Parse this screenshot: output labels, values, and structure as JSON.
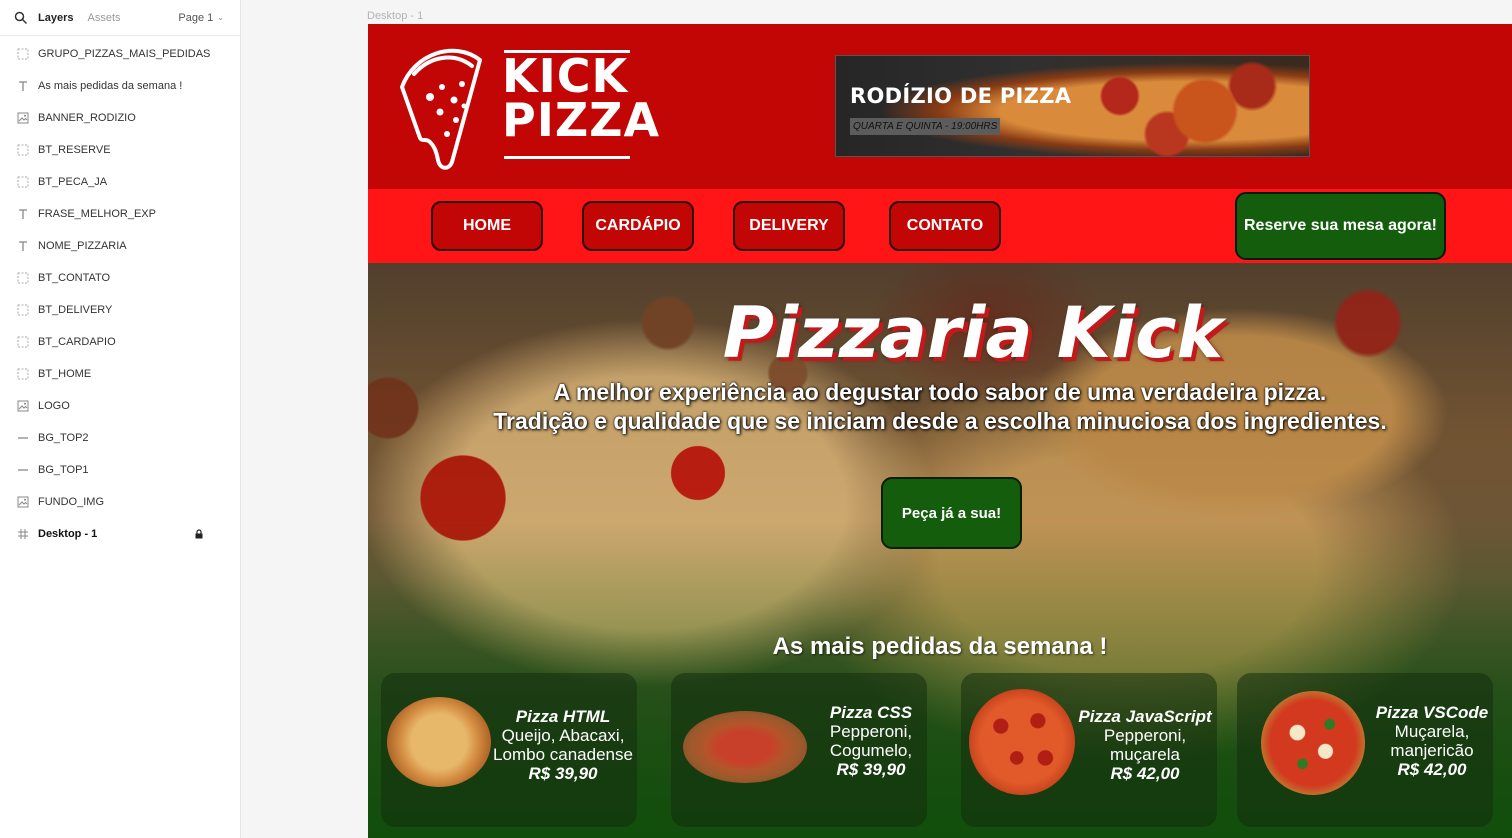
{
  "panel": {
    "tab_layers": "Layers",
    "tab_assets": "Assets",
    "page_selector": "Page 1",
    "layers": [
      {
        "label": "GRUPO_PIZZAS_MAIS_PEDIDAS",
        "icon": "frame-icon"
      },
      {
        "label": "As mais pedidas da semana !",
        "icon": "text-icon"
      },
      {
        "label": "BANNER_RODIZIO",
        "icon": "image-icon"
      },
      {
        "label": "BT_RESERVE",
        "icon": "frame-icon"
      },
      {
        "label": "BT_PECA_JA",
        "icon": "frame-icon"
      },
      {
        "label": "FRASE_MELHOR_EXP",
        "icon": "text-icon"
      },
      {
        "label": "NOME_PIZZARIA",
        "icon": "text-icon"
      },
      {
        "label": "BT_CONTATO",
        "icon": "frame-icon"
      },
      {
        "label": "BT_DELIVERY",
        "icon": "frame-icon"
      },
      {
        "label": "BT_CARDAPIO",
        "icon": "frame-icon"
      },
      {
        "label": "BT_HOME",
        "icon": "frame-icon"
      },
      {
        "label": "LOGO",
        "icon": "image-icon"
      },
      {
        "label": "BG_TOP2",
        "icon": "rectangle-icon"
      },
      {
        "label": "BG_TOP1",
        "icon": "rectangle-icon"
      },
      {
        "label": "FUNDO_IMG",
        "icon": "image-icon"
      },
      {
        "label": "Desktop - 1",
        "icon": "frame-hash-icon",
        "locked": true
      }
    ]
  },
  "canvas": {
    "frame_label": "Desktop - 1",
    "logo": {
      "line1": "KICK",
      "line2": "PIZZA"
    },
    "banner": {
      "title": "RODÍZIO DE PIZZA",
      "subtitle": "QUARTA E QUINTA - 19:00HRS"
    },
    "nav": {
      "home": "HOME",
      "cardapio": "CARDÁPIO",
      "delivery": "DELIVERY",
      "contato": "CONTATO"
    },
    "reserve_button": "Reserve sua mesa agora!",
    "hero": {
      "title": "Pizzaria Kick",
      "line1": "A melhor experiência ao degustar todo sabor de uma verdadeira pizza.",
      "line2": "Tradição e qualidade que se iniciam desde a escolha minuciosa dos ingredientes.",
      "cta": "Peça já a sua!"
    },
    "mais_pedidas": "As mais pedidas da semana !",
    "pizzas": [
      {
        "name": "Pizza HTML",
        "desc1": "Queijo, Abacaxi,",
        "desc2": "Lombo canadense",
        "price": "R$ 39,90"
      },
      {
        "name": "Pizza CSS",
        "desc1": "Pepperoni,",
        "desc2": "Cogumelo,",
        "price": "R$ 39,90"
      },
      {
        "name": "Pizza JavaScript",
        "desc1": "Pepperoni,",
        "desc2": "muçarela",
        "price": "R$ 42,00"
      },
      {
        "name": "Pizza VSCode",
        "desc1": "Muçarela,",
        "desc2": "manjericão",
        "price": "R$ 42,00"
      }
    ]
  },
  "colors": {
    "red_dark": "#c20606",
    "red_light": "#ff1515",
    "green": "#145d0c"
  }
}
